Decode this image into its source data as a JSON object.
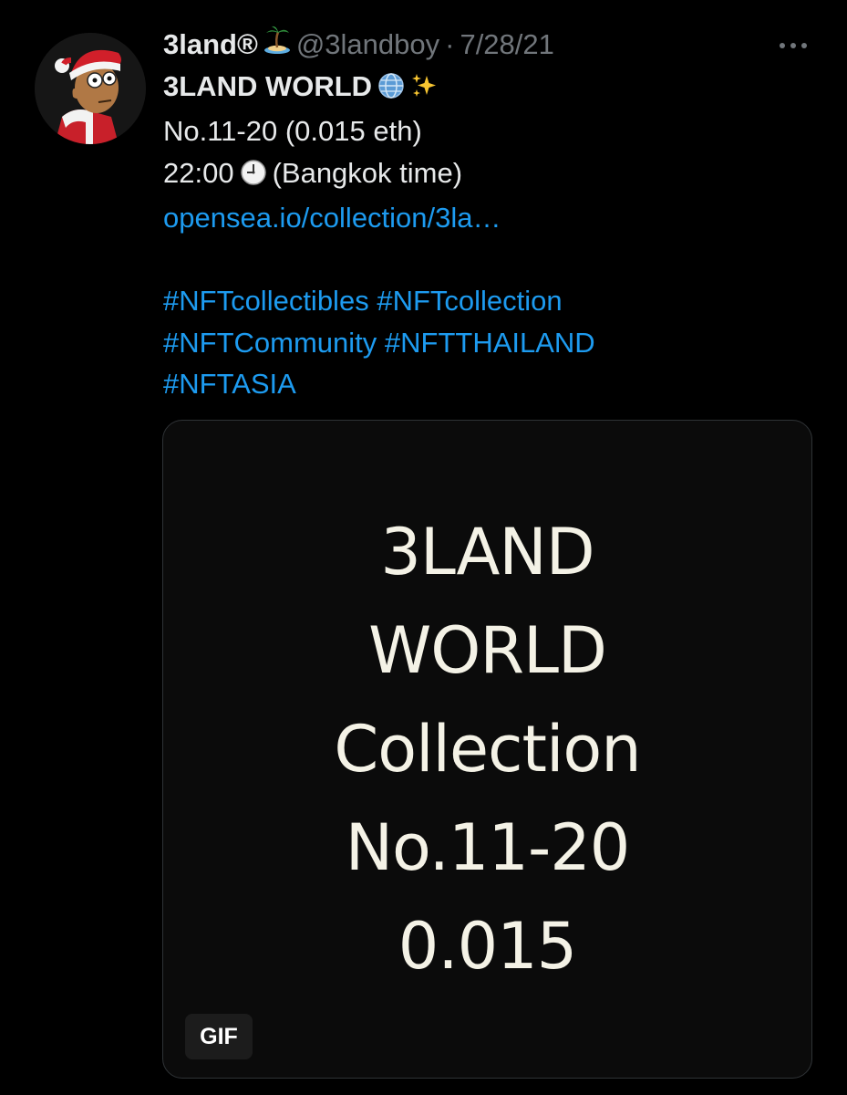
{
  "tweet": {
    "author_name": "3land®",
    "name_emoji": "desert-island-emoji",
    "handle": "@3landboy",
    "separator": "·",
    "date": "7/28/21",
    "more_icon": "more-horizontal-icon",
    "line1_text": "3LAND WORLD",
    "line1_emojis": [
      "globe-emoji",
      "sparkles-emoji"
    ],
    "line2_text": "No.11-20 (0.015 eth)",
    "line3_time": "22:00",
    "line3_emoji": "clock-emoji",
    "line3_rest": "(Bangkok time)",
    "link": "opensea.io/collection/3la…",
    "hashtag_lines": [
      [
        "#NFTcollectibles",
        "#NFTcollection"
      ],
      [
        "#NFTCommunity",
        "#NFTTHAILAND"
      ],
      [
        "#NFTASIA"
      ]
    ]
  },
  "media": {
    "lines": [
      "3LAND",
      "WORLD",
      "Collection",
      "No.11-20",
      "0.015"
    ],
    "badge": "GIF"
  },
  "colors": {
    "background": "#000000",
    "text": "#e7e9ea",
    "muted": "#71767b",
    "link": "#1d9bf0",
    "media_text": "#f4f2e6"
  }
}
